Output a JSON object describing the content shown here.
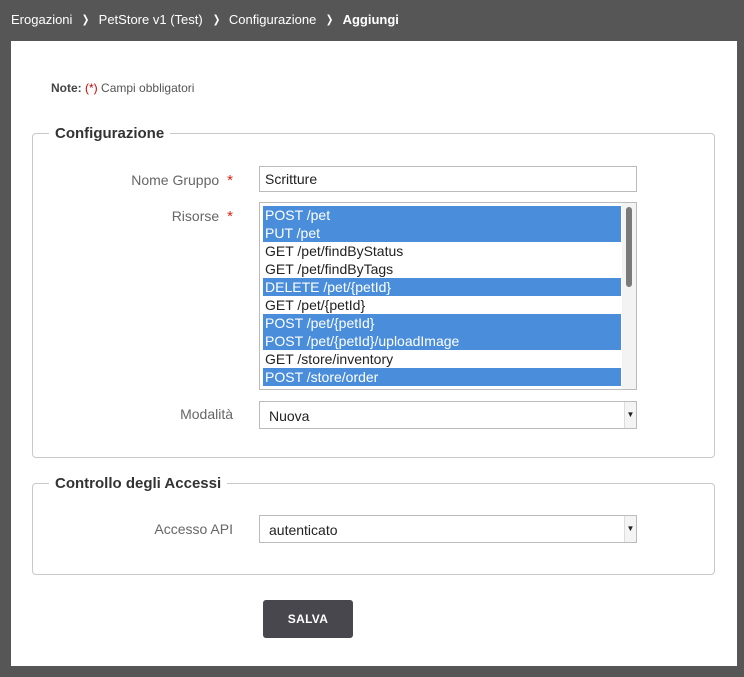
{
  "breadcrumb": {
    "items": [
      "Erogazioni",
      "PetStore v1 (Test)",
      "Configurazione",
      "Aggiungi"
    ]
  },
  "note": {
    "label": "Note:",
    "required_marker": "(*)",
    "text": "Campi obbligatori"
  },
  "configurazione": {
    "legend": "Configurazione",
    "nome_gruppo": {
      "label": "Nome Gruppo",
      "required": "*",
      "value": "Scritture"
    },
    "risorse": {
      "label": "Risorse",
      "required": "*",
      "options": [
        {
          "label": "POST /pet",
          "selected": true
        },
        {
          "label": "PUT /pet",
          "selected": true
        },
        {
          "label": "GET /pet/findByStatus",
          "selected": false
        },
        {
          "label": "GET /pet/findByTags",
          "selected": false
        },
        {
          "label": "DELETE /pet/{petId}",
          "selected": true
        },
        {
          "label": "GET /pet/{petId}",
          "selected": false
        },
        {
          "label": "POST /pet/{petId}",
          "selected": true
        },
        {
          "label": "POST /pet/{petId}/uploadImage",
          "selected": true
        },
        {
          "label": "GET /store/inventory",
          "selected": false
        },
        {
          "label": "POST /store/order",
          "selected": true
        }
      ]
    },
    "modalita": {
      "label": "Modalità",
      "value": "Nuova"
    }
  },
  "controllo_accessi": {
    "legend": "Controllo degli Accessi",
    "accesso_api": {
      "label": "Accesso API",
      "value": "autenticato"
    }
  },
  "actions": {
    "save_label": "SALVA"
  },
  "colors": {
    "selected_option": "#4a8edb",
    "required_star": "#d21",
    "save_button": "#47474d",
    "frame_background": "#565656"
  }
}
